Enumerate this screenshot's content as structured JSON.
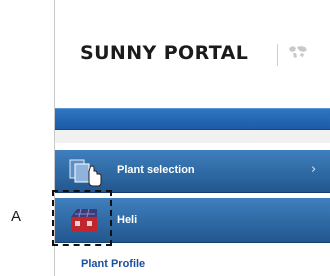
{
  "brand": {
    "title": "SUNNY PORTAL",
    "logo_icon": "world-map-icon"
  },
  "nav": {
    "plant_selection": {
      "label": "Plant selection",
      "icon": "plant-selection-icon",
      "chevron": "›"
    },
    "heli": {
      "label": "Heli",
      "icon": "plant-icon"
    }
  },
  "subnav": {
    "plant_profile": "Plant Profile"
  },
  "annotation": {
    "letter": "A"
  },
  "colors": {
    "nav_blue_top": "#3e7fbd",
    "nav_blue_bottom": "#23578f",
    "header_bar": "#2f76c2",
    "link_blue": "#1a4f9c"
  }
}
